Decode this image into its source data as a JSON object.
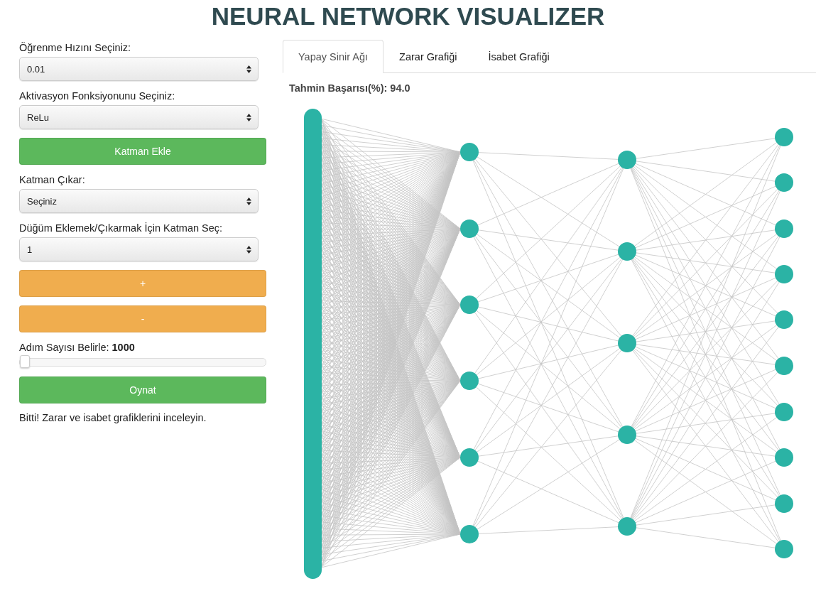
{
  "title": "NEURAL NETWORK VISUALIZER",
  "controls": [
    {
      "kind": "select",
      "label": "Öğrenme Hızını Seçiniz:",
      "value": "0.01"
    },
    {
      "kind": "select",
      "label": "Aktivasyon Fonksiyonunu Seçiniz:",
      "value": "ReLu"
    },
    {
      "kind": "button",
      "label": "Katman Ekle",
      "color": "#5cb85c"
    },
    {
      "kind": "select",
      "label": "Katman Çıkar:",
      "value": "Seçiniz"
    },
    {
      "kind": "select",
      "label": "Düğüm Eklemek/Çıkarmak İçin Katman Seç:",
      "value": "1"
    },
    {
      "kind": "button",
      "label": "+",
      "color": "#f0ad4e"
    },
    {
      "kind": "button",
      "label": "-",
      "color": "#f0ad4e"
    },
    {
      "kind": "slider",
      "label": "Adım Sayısı Belirle:",
      "value": "1000",
      "level": 0.0
    },
    {
      "kind": "button",
      "label": "Oynat",
      "color": "#5cb85c"
    },
    {
      "kind": "message",
      "label": "Bitti! Zarar ve isabet grafiklerini inceleyin."
    }
  ],
  "tabs": [
    {
      "label": "Yapay Sinir Ağı",
      "selected": true
    },
    {
      "label": "Zarar Grafiği",
      "selected": false
    },
    {
      "label": "İsabet Grafiği",
      "selected": false
    }
  ],
  "accuracy": "Tahmin Başarısı(%): 94.0"
}
